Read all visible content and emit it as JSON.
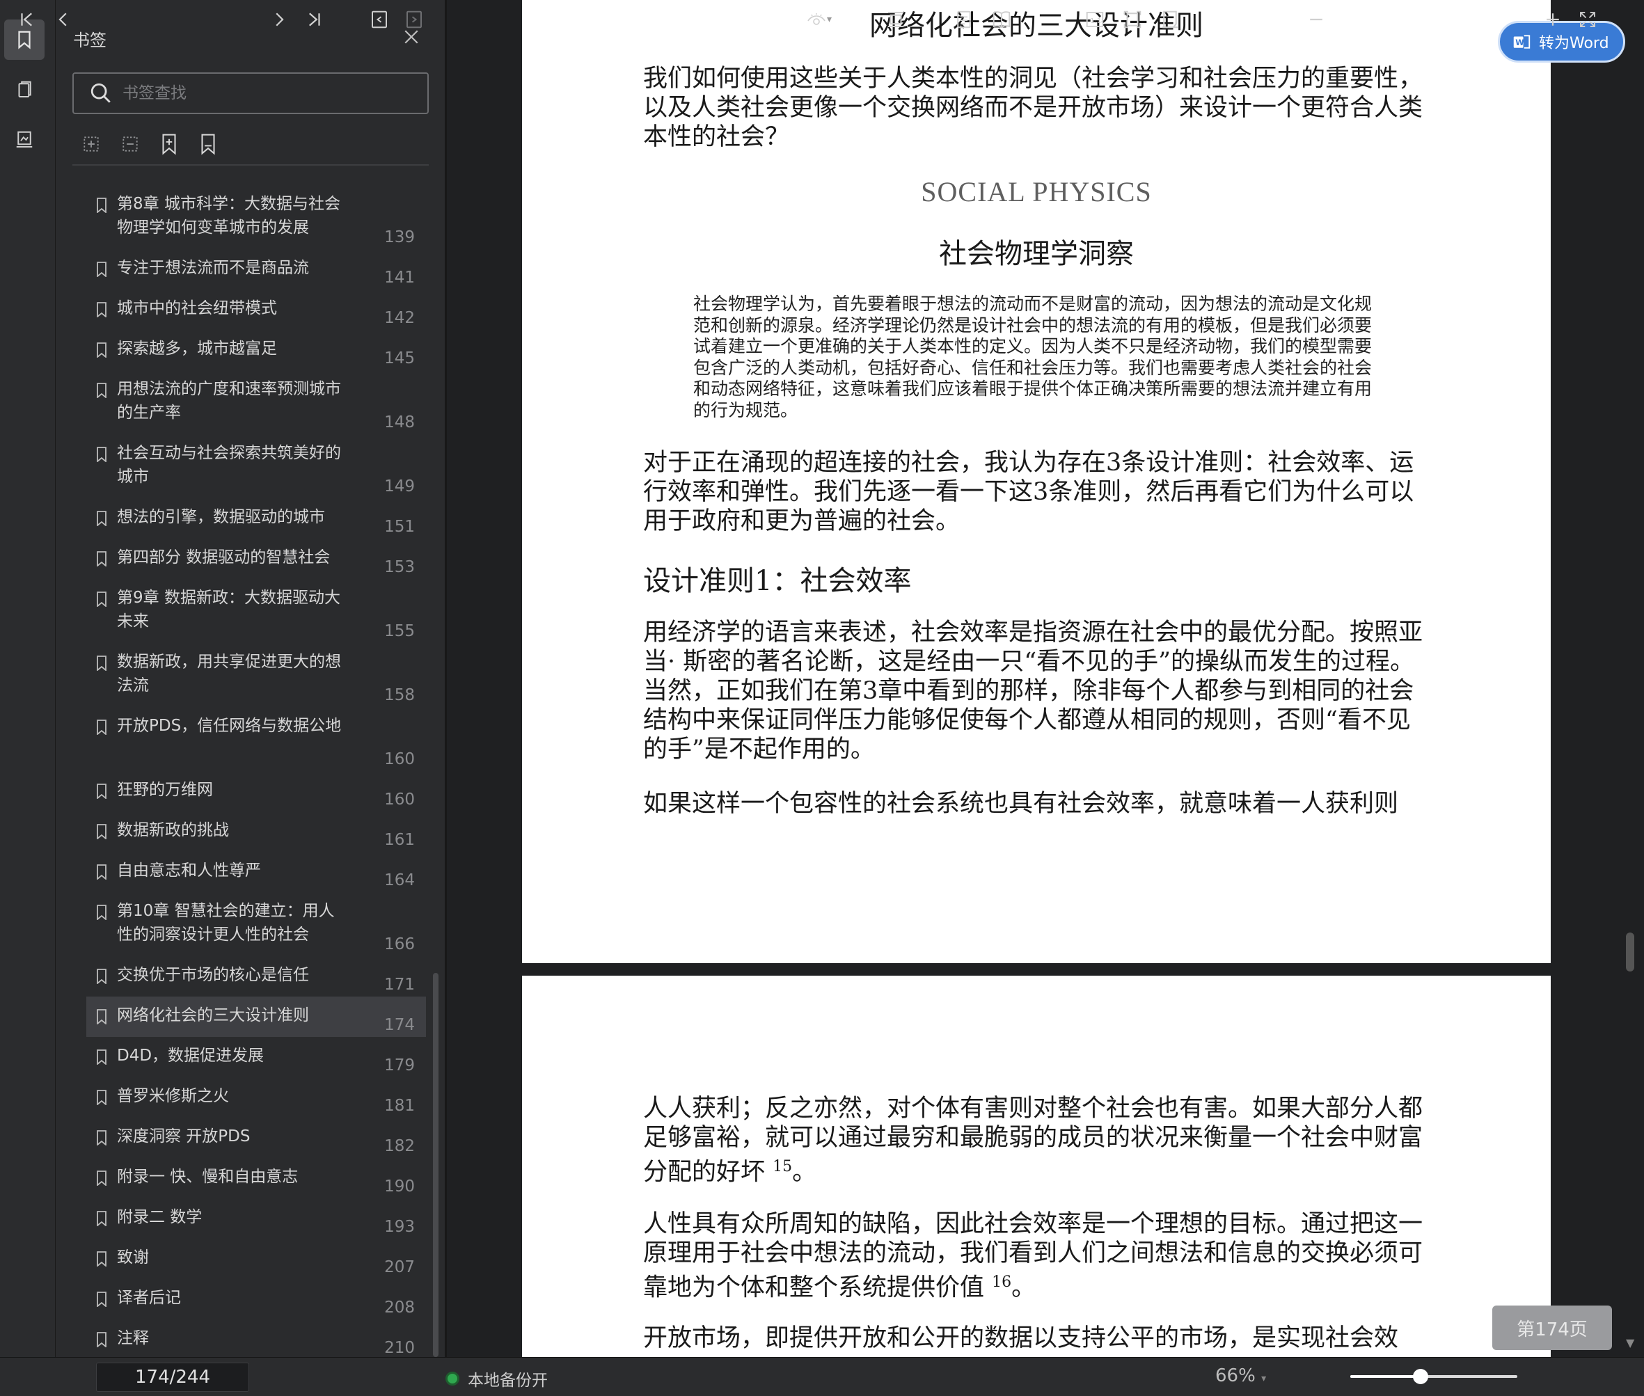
{
  "app": {
    "theme_bg": "#1e1f21",
    "accent": "#3a7bd5"
  },
  "rail": {
    "items": [
      {
        "name": "bookmark-icon",
        "active": true
      },
      {
        "name": "pages-icon",
        "active": false
      },
      {
        "name": "annotation-icon",
        "active": false
      }
    ]
  },
  "panel": {
    "title": "书签",
    "search_placeholder": "书签查找",
    "tools": [
      "expand-all-icon",
      "collapse-all-icon",
      "add-bookmark-icon",
      "bookmark-outline-icon"
    ],
    "items": [
      {
        "label": "第8章 城市科学：大数据与社会物理学如何变革城市的发展",
        "page": "139"
      },
      {
        "label": "专注于想法流而不是商品流",
        "page": "141"
      },
      {
        "label": "城市中的社会纽带模式",
        "page": "142"
      },
      {
        "label": "探索越多，城市越富足",
        "page": "145"
      },
      {
        "label": "用想法流的广度和速率预测城市的生产率",
        "page": "148"
      },
      {
        "label": "社会互动与社会探索共筑美好的城市",
        "page": "149"
      },
      {
        "label": "想法的引擎，数据驱动的城市",
        "page": "151"
      },
      {
        "label": "第四部分 数据驱动的智慧社会",
        "page": "153"
      },
      {
        "label": "第9章 数据新政：大数据驱动大未来",
        "page": "155"
      },
      {
        "label": "数据新政，用共享促进更大的想法流",
        "page": "158"
      },
      {
        "label": "开放PDS，信任网络与数据公地",
        "page": "160"
      },
      {
        "label": "狂野的万维网",
        "page": "160"
      },
      {
        "label": "数据新政的挑战",
        "page": "161"
      },
      {
        "label": "自由意志和人性尊严",
        "page": "164"
      },
      {
        "label": "第10章 智慧社会的建立：用人性的洞察设计更人性的社会",
        "page": "166"
      },
      {
        "label": "交换优于市场的核心是信任",
        "page": "171"
      },
      {
        "label": "网络化社会的三大设计准则",
        "page": "174",
        "active": true
      },
      {
        "label": "D4D，数据促进发展",
        "page": "179"
      },
      {
        "label": "普罗米修斯之火",
        "page": "181"
      },
      {
        "label": "深度洞察 开放PDS",
        "page": "182"
      },
      {
        "label": "附录一 快、慢和自由意志",
        "page": "190"
      },
      {
        "label": "附录二 数学",
        "page": "193"
      },
      {
        "label": "致谢",
        "page": "207"
      },
      {
        "label": "译者后记",
        "page": "208"
      },
      {
        "label": "注释",
        "page": "210"
      }
    ]
  },
  "document": {
    "page1": {
      "title": "网络化社会的三大设计准则",
      "p1": "我们如何使用这些关于人类本性的洞见（社会学习和社会压力的重要性，以及人类社会更像一个交换网络而不是开放市场）来设计一个更符合人类本性的社会？",
      "social_physics": "SOCIAL PHYSICS",
      "subhead": "社会物理学洞察",
      "quote": "社会物理学认为，首先要着眼于想法的流动而不是财富的流动，因为想法的流动是文化规范和创新的源泉。经济学理论仍然是设计社会中的想法流的有用的模板，但是我们必须要试着建立一个更准确的关于人类本性的定义。因为人类不只是经济动物，我们的模型需要包含广泛的人类动机，包括好奇心、信任和社会压力等。我们也需要考虑人类社会的社会和动态网络特征，这意味着我们应该着眼于提供个体正确决策所需要的想法流并建立有用的行为规范。",
      "p2": "对于正在涌现的超连接的社会，我认为存在3条设计准则：社会效率、运行效率和弹性。我们先逐一看一下这3条准则，然后再看它们为什么可以用于政府和更为普遍的社会。",
      "h2": "设计准则1：社会效率",
      "p3": "用经济学的语言来表述，社会效率是指资源在社会中的最优分配。按照亚当· 斯密的著名论断，这是经由一只“看不见的手”的操纵而发生的过程。当然，正如我们在第3章中看到的那样，除非每个人都参与到相同的社会结构中来保证同伴压力能够促使每个人都遵从相同的规则，否则“看不见的手”是不起作用的。",
      "p4": "如果这样一个包容性的社会系统也具有社会效率，就意味着一人获利则"
    },
    "page2": {
      "p1": "人人获利；反之亦然，对个体有害则对整个社会也有害。如果大部分人都足够富裕，就可以通过最穷和最脆弱的成员的状况来衡量一个社会中财富分配的好坏",
      "p1_note": "15",
      "p1_end": "。",
      "p2": "人性具有众所周知的缺陷，因此社会效率是一个理想的目标。通过把这一原理用于社会中想法的流动，我们看到人们之间想法和信息的交换必须可靠地为个体和整个系统提供价值",
      "p2_note": "16",
      "p2_end": "。",
      "p3": "开放市场，即提供开放和公开的数据以支持公平的市场，是实现社会效"
    }
  },
  "word_button": "转为Word",
  "page_badge": "第174页",
  "bottom": {
    "page_input": "174/244",
    "backup": "本地备份开",
    "zoom": "66%",
    "zoom_level": 0.42
  }
}
